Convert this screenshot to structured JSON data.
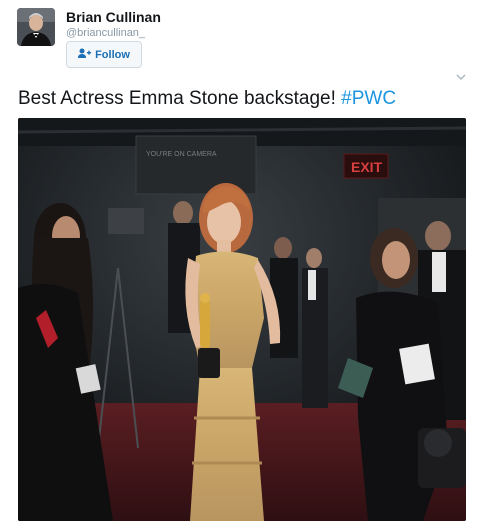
{
  "user": {
    "display_name": "Brian Cullinan",
    "handle": "@briancullinan_",
    "follow_label": "Follow"
  },
  "tweet": {
    "text": "Best Actress Emma Stone backstage! ",
    "hashtag": "#PWC"
  },
  "photo": {
    "sign_exit": "EXIT",
    "sign_backdrop": "YOU'RE ON CAMERA"
  },
  "icons": {
    "follow": "add-user-icon",
    "caret": "chevron-down-icon"
  },
  "colors": {
    "accent": "#1b95e0",
    "follow_text": "#1c6fb5"
  }
}
